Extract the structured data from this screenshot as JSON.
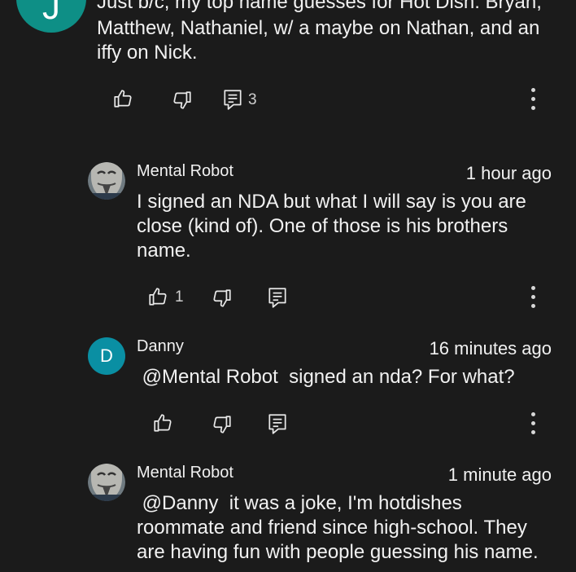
{
  "comments": [
    {
      "avatar_letter": "J",
      "text_lines": [
        "Just b/c, my top name guesses for Hot Dish: Bryan,",
        "Matthew, Nathaniel, w/ a maybe on Nathan, and an",
        "iffy on Nick."
      ],
      "reply_count": "3"
    },
    {
      "author": "Mental Robot",
      "time": "1 hour ago",
      "text_lines": [
        "I signed an NDA but what I will say is you are",
        "close (kind of). One of those is his brothers",
        "name."
      ],
      "like_count": "1"
    },
    {
      "author": "Danny",
      "avatar_letter": "D",
      "time": "16 minutes ago",
      "text_lines": [
        " @Mental Robot  signed an nda? For what?"
      ]
    },
    {
      "author": "Mental Robot",
      "time": "1 minute ago",
      "text_lines": [
        " @Danny  it was a joke, I'm hotdishes",
        "roommate and friend since high-school. They",
        "are having fun with people guessing his name."
      ]
    }
  ],
  "colors": {
    "background": "#1b1b1b",
    "text": "#f1f1f1",
    "avatar_teal": "#0e8f86",
    "avatar_d": "#0a8fa3"
  }
}
